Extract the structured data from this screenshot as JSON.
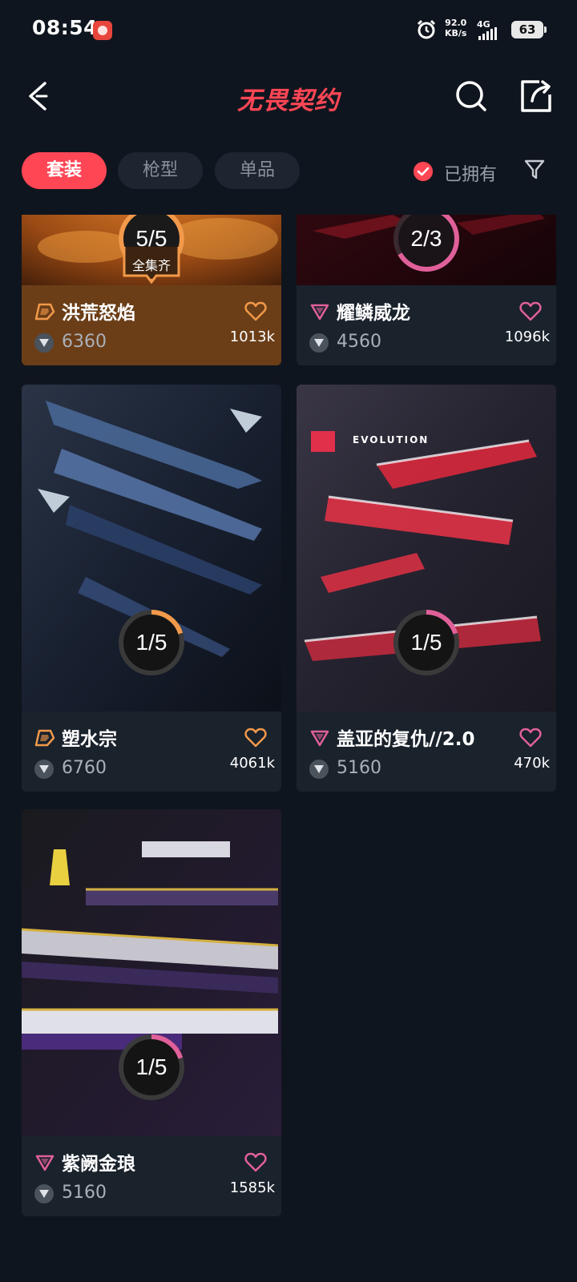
{
  "status_bar": {
    "time": "08:54",
    "speed_value": "92.0",
    "speed_unit": "KB/s",
    "network": "4G",
    "battery": "63"
  },
  "header": {
    "title": "无畏契约",
    "back_icon": "chevron-left-icon",
    "search_icon": "search-icon",
    "share_icon": "share-icon"
  },
  "tabs": [
    {
      "label": "套装",
      "active": true
    },
    {
      "label": "枪型",
      "active": false
    },
    {
      "label": "单品",
      "active": false
    }
  ],
  "owned_filter": {
    "label": "已拥有",
    "checked": true
  },
  "filter_icon": "filter-funnel-icon",
  "colors": {
    "accent": "#ff4655",
    "background": "#0f151e",
    "card": "#1a222c",
    "tier_orange": "#f2994a",
    "tier_pink": "#e0609a"
  },
  "cards": [
    {
      "name": "洪荒怒焰",
      "price": "6360",
      "likes": "1013k",
      "progress": "5/5",
      "progress_fraction": 1.0,
      "badge": "全集齐",
      "tier": "orange"
    },
    {
      "name": "耀鳞威龙",
      "price": "4560",
      "likes": "1096k",
      "progress": "2/3",
      "progress_fraction": 0.667,
      "tier": "pink"
    },
    {
      "name": "塑水宗",
      "price": "6760",
      "likes": "4061k",
      "progress": "1/5",
      "progress_fraction": 0.2,
      "tier": "orange"
    },
    {
      "name": "盖亚的复仇//2.0",
      "price": "5160",
      "likes": "470k",
      "progress": "1/5",
      "progress_fraction": 0.2,
      "tier": "pink",
      "image_caption": "EVOLUTION"
    },
    {
      "name": "紫阙金琅",
      "price": "5160",
      "likes": "1585k",
      "progress": "1/5",
      "progress_fraction": 0.2,
      "tier": "pink"
    }
  ]
}
